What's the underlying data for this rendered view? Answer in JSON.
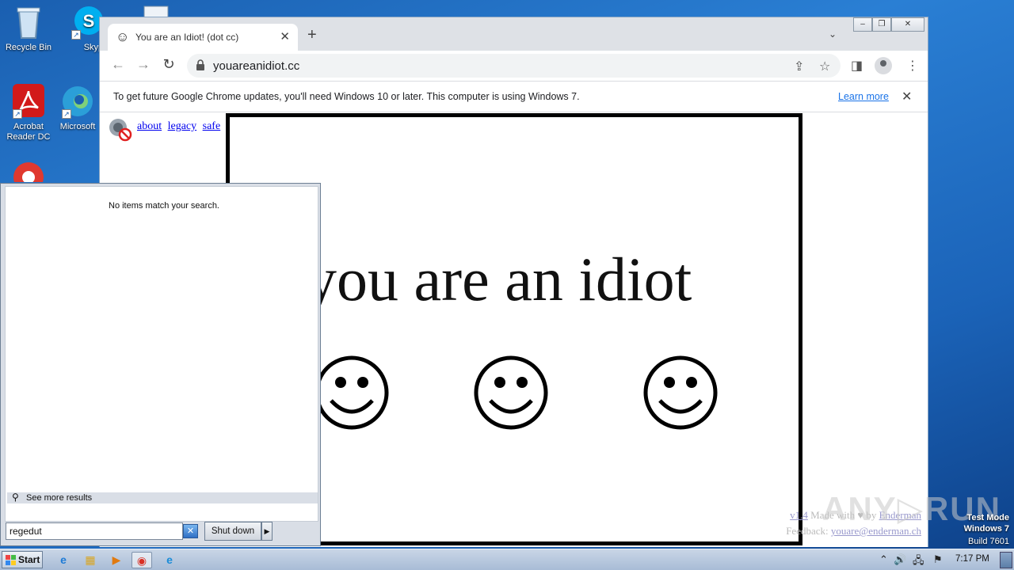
{
  "desktop": {
    "icons": [
      {
        "label": "Recycle Bin"
      },
      {
        "label": "Skype"
      },
      {
        "label": "Acrobat Reader DC"
      },
      {
        "label": "Microsoft"
      }
    ]
  },
  "chrome": {
    "tab": {
      "favicon": "☺",
      "title": "You are an Idiot! (dot cc)",
      "close": "✕"
    },
    "new_tab": "+",
    "tab_search": "⌄",
    "window_buttons": {
      "minimize": "–",
      "restore": "❐",
      "close": "✕"
    },
    "nav": {
      "back": "←",
      "forward": "→",
      "reload": "↻"
    },
    "url": "youareanidiot.cc",
    "omnibox_icons": {
      "share": "⇪",
      "bookmark": "☆"
    },
    "sidepanel": "◨",
    "menu": "⋮",
    "infobar": {
      "message": "To get future Google Chrome updates, you'll need Windows 10 or later. This computer is using Windows 7.",
      "learn_more": "Learn more",
      "close": "✕"
    }
  },
  "page": {
    "links": [
      "about",
      "legacy",
      "safe"
    ],
    "headline": "you are an idiot",
    "footer": {
      "version": "v1.4",
      "made_with": " Made with ",
      "heart": "♥",
      "by": " by ",
      "author": "Enderman",
      "feedback_label": "Feedback: ",
      "email": "youare@enderman.ch"
    }
  },
  "start_menu": {
    "no_items": "No items match your search.",
    "see_more": "See more results",
    "search_value": "regedut",
    "clear_icon": "✕",
    "shut_down": "Shut down",
    "shut_down_arrow": "▶"
  },
  "taskbar": {
    "start": "Start",
    "apps": [
      {
        "name": "ie-icon",
        "glyph": "e"
      },
      {
        "name": "explorer-icon",
        "glyph": "▦"
      },
      {
        "name": "media-player-icon",
        "glyph": "▶"
      },
      {
        "name": "chrome-icon",
        "glyph": "◉"
      },
      {
        "name": "edge-icon",
        "glyph": "e"
      }
    ],
    "tray": {
      "chevron": "⌃",
      "volume": "🔊",
      "network": "🖧",
      "flag": "⚑"
    },
    "clock": "7:17 PM"
  },
  "overlay": {
    "test_mode": "Test Mode",
    "windows": "Windows 7",
    "build": "Build 7601",
    "watermark": "ANY▷RUN"
  }
}
